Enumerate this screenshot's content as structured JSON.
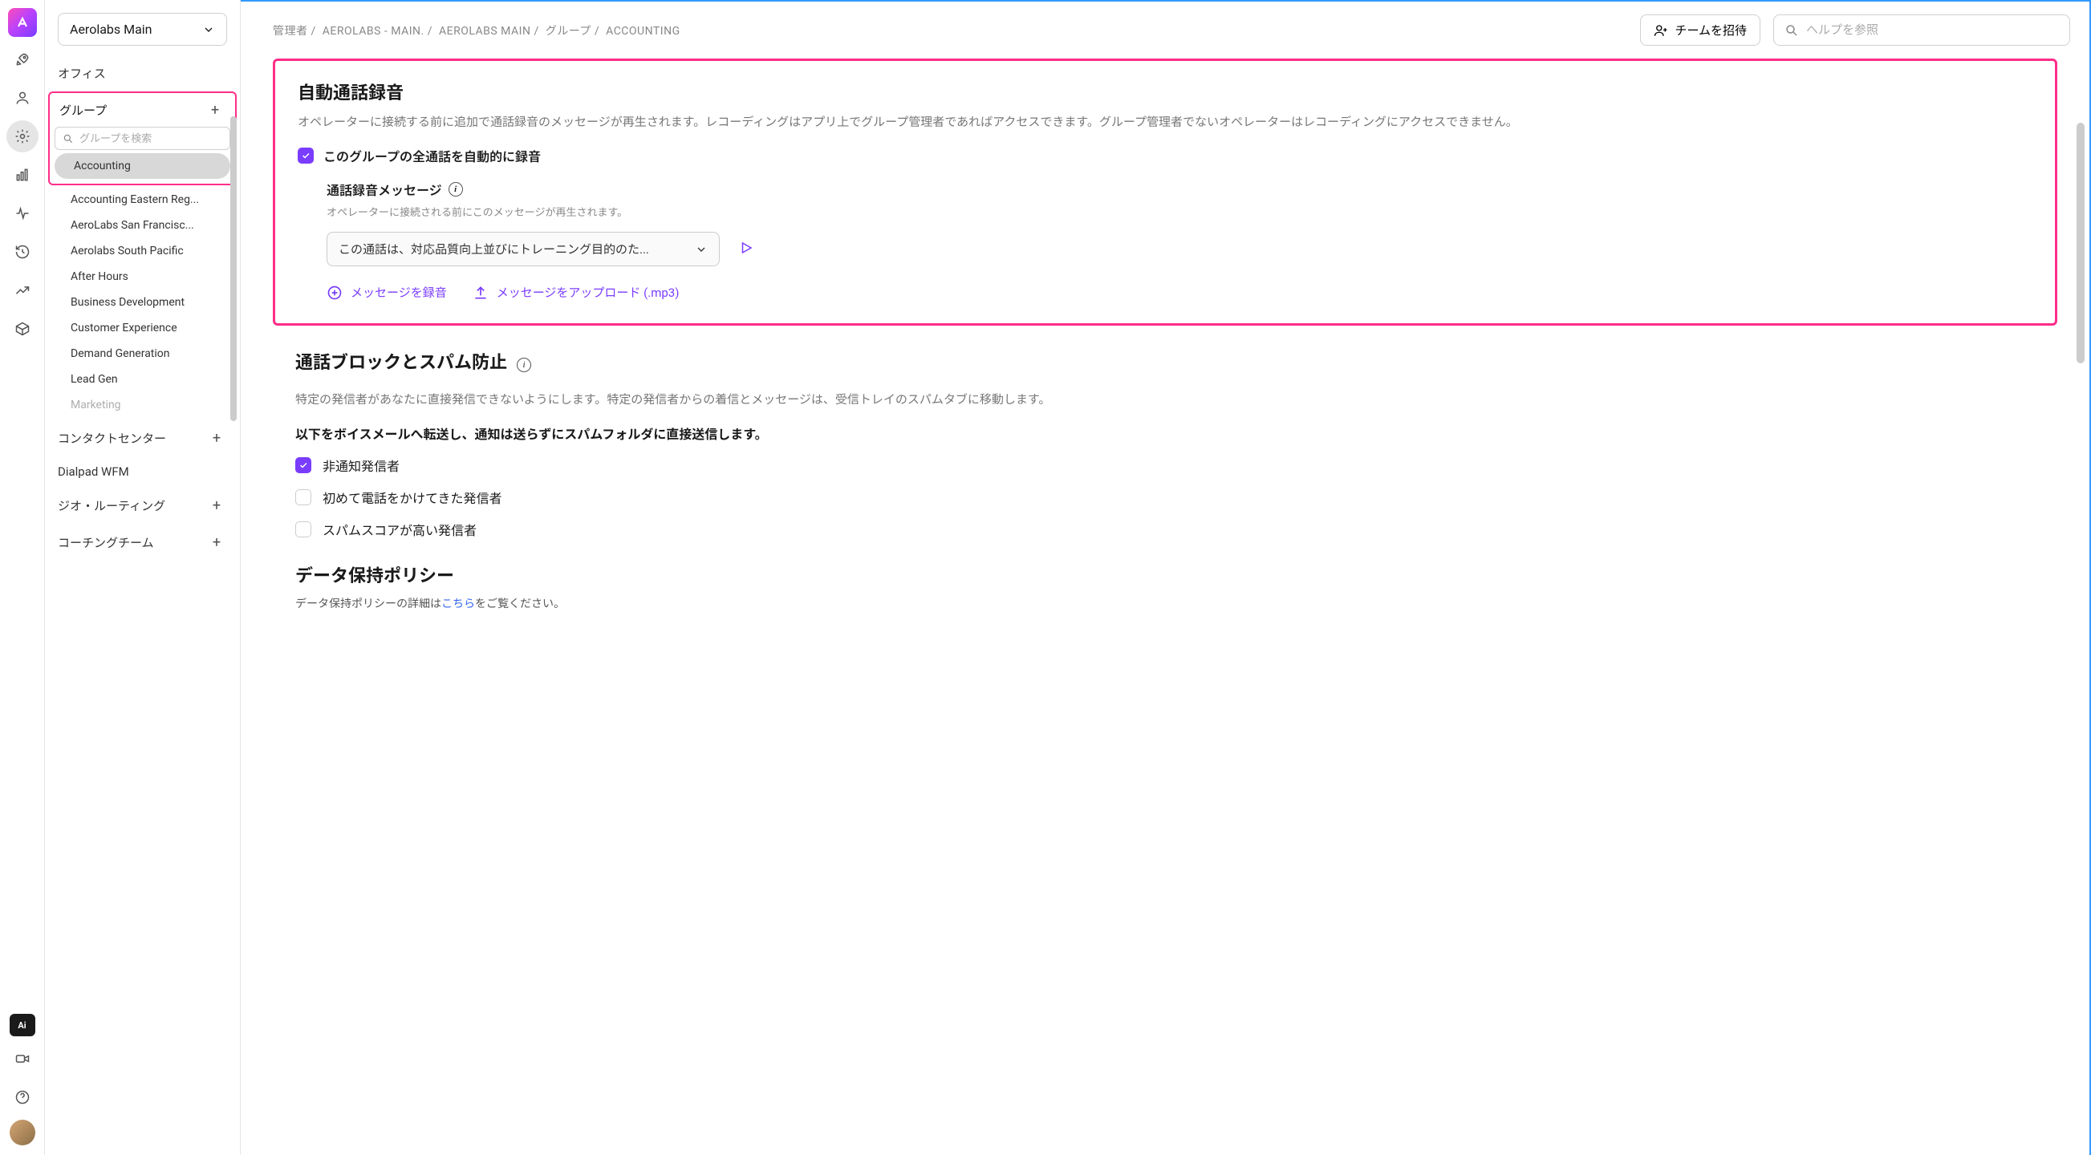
{
  "org": {
    "name": "Aerolabs Main"
  },
  "sidebar": {
    "office": "オフィス",
    "groups_label": "グループ",
    "search_placeholder": "グループを検索",
    "groups": [
      {
        "label": "Accounting",
        "active": true
      },
      {
        "label": "Accounting Eastern Reg...",
        "active": false
      },
      {
        "label": "AeroLabs San Francisc...",
        "active": false
      },
      {
        "label": "Aerolabs South Pacific",
        "active": false
      },
      {
        "label": "After Hours",
        "active": false
      },
      {
        "label": "Business Development",
        "active": false
      },
      {
        "label": "Customer Experience",
        "active": false
      },
      {
        "label": "Demand Generation",
        "active": false
      },
      {
        "label": "Lead Gen",
        "active": false
      },
      {
        "label": "Marketing",
        "active": false
      }
    ],
    "contact_center": "コンタクトセンター",
    "wfm": "Dialpad WFM",
    "geo_routing": "ジオ・ルーティング",
    "coaching": "コーチングチーム"
  },
  "breadcrumb": {
    "parts": [
      "管理者",
      "AEROLABS - MAIN.",
      "AEROLABS MAIN",
      "グループ",
      "ACCOUNTING"
    ]
  },
  "topbar": {
    "invite": "チームを招待",
    "help_placeholder": "ヘルプを参照"
  },
  "recording": {
    "title": "自動通話録音",
    "desc": "オペレーターに接続する前に追加で通話録音のメッセージが再生されます。レコーディングはアプリ上でグループ管理者であればアクセスできます。グループ管理者でないオペレーターはレコーディングにアクセスできません。",
    "checkbox_label": "このグループの全通話を自動的に録音",
    "message_header": "通話録音メッセージ",
    "message_desc": "オペレーターに接続される前にこのメッセージが再生されます。",
    "select_value": "この通話は、対応品質向上並びにトレーニング目的のた...",
    "record_action": "メッセージを録音",
    "upload_action": "メッセージをアップロード (.mp3)"
  },
  "spam": {
    "title": "通話ブロックとスパム防止",
    "desc": "特定の発信者があなたに直接発信できないようにします。特定の発信者からの着信とメッセージは、受信トレイのスパムタブに移動します。",
    "note": "以下をボイスメールへ転送し、通知は送らずにスパムフォルダに直接送信します。",
    "items": [
      {
        "label": "非通知発信者",
        "checked": true
      },
      {
        "label": "初めて電話をかけてきた発信者",
        "checked": false
      },
      {
        "label": "スパムスコアが高い発信者",
        "checked": false
      }
    ]
  },
  "policy": {
    "title": "データ保持ポリシー",
    "desc_pre": "データ保持ポリシーの詳細は",
    "link": "こちら",
    "desc_post": "をご覧ください。"
  }
}
